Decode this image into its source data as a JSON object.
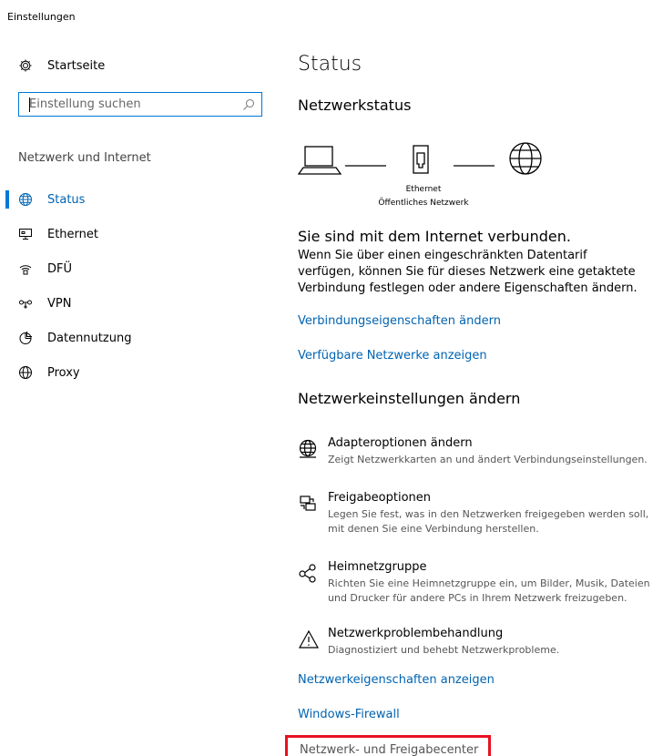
{
  "window": {
    "title": "Einstellungen"
  },
  "sidebar": {
    "home_label": "Startseite",
    "search_placeholder": "Einstellung suchen",
    "section_label": "Netzwerk und Internet",
    "items": [
      {
        "label": "Status",
        "icon": "globe-icon",
        "active": true
      },
      {
        "label": "Ethernet",
        "icon": "ethernet-icon"
      },
      {
        "label": "DFÜ",
        "icon": "dialup-icon"
      },
      {
        "label": "VPN",
        "icon": "vpn-icon"
      },
      {
        "label": "Datennutzung",
        "icon": "data-usage-icon"
      },
      {
        "label": "Proxy",
        "icon": "globe-icon"
      }
    ]
  },
  "main": {
    "title": "Status",
    "network_status_heading": "Netzwerkstatus",
    "diagram": {
      "adapter_label": "Ethernet",
      "network_label": "Öffentliches Netzwerk"
    },
    "connected_text": "Sie sind mit dem Internet verbunden.",
    "connected_desc": "Wenn Sie über einen eingeschränkten Datentarif verfügen, können Sie für dieses Netzwerk eine getaktete Verbindung festlegen oder andere Eigenschaften ändern.",
    "link_properties": "Verbindungseigenschaften ändern",
    "link_available": "Verfügbare Netzwerke anzeigen",
    "change_heading": "Netzwerkeinstellungen ändern",
    "options": [
      {
        "title": "Adapteroptionen ändern",
        "desc": "Zeigt Netzwerkkarten an und ändert Verbindungseinstellungen.",
        "icon": "adapter-globe-icon"
      },
      {
        "title": "Freigabeoptionen",
        "desc": "Legen Sie fest, was in den Netzwerken freigegeben werden soll, mit denen Sie eine Verbindung herstellen.",
        "icon": "sharing-icon"
      },
      {
        "title": "Heimnetzgruppe",
        "desc": "Richten Sie eine Heimnetzgruppe ein, um Bilder, Musik, Dateien und Drucker für andere PCs in Ihrem Netzwerk freizugeben.",
        "icon": "homegroup-icon"
      },
      {
        "title": "Netzwerkproblembehandlung",
        "desc": "Diagnostiziert und behebt Netzwerkprobleme.",
        "icon": "warning-icon"
      }
    ],
    "link_net_properties": "Netzwerkeigenschaften anzeigen",
    "link_firewall": "Windows-Firewall",
    "link_center": "Netzwerk- und Freigabecenter"
  },
  "colors": {
    "accent": "#0078d7",
    "link": "#0063b1",
    "highlight": "#e81123"
  }
}
